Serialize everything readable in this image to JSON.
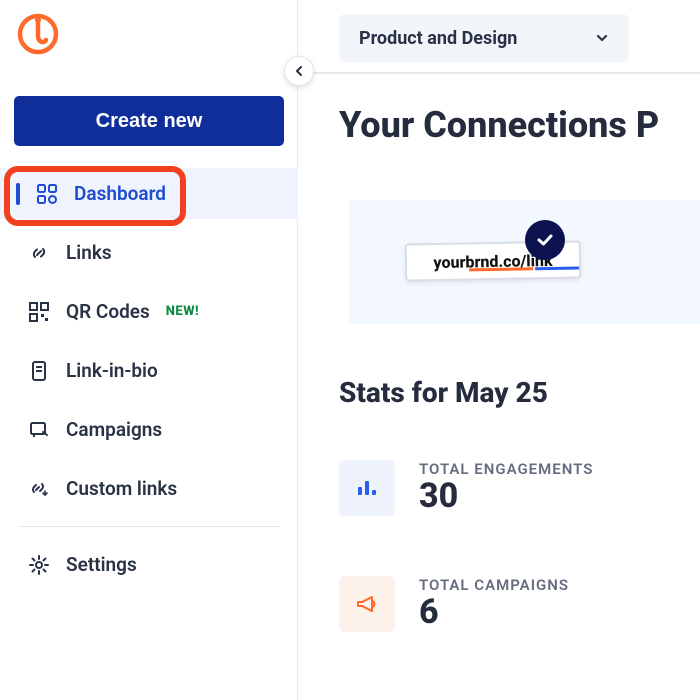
{
  "brand": {
    "name": "Bitly"
  },
  "sidebar": {
    "create_label": "Create new",
    "items": [
      {
        "label": "Dashboard"
      },
      {
        "label": "Links"
      },
      {
        "label": "QR Codes",
        "badge": "NEW!"
      },
      {
        "label": "Link-in-bio"
      },
      {
        "label": "Campaigns"
      },
      {
        "label": "Custom links"
      },
      {
        "label": "Settings"
      }
    ]
  },
  "header": {
    "workspace_selector": "Product and Design"
  },
  "main": {
    "title": "Your Connections P",
    "promo_link_text": "yourbrnd.co/link",
    "stats_title": "Stats for May 25",
    "stats": [
      {
        "label": "TOTAL ENGAGEMENTS",
        "value": "30"
      },
      {
        "label": "TOTAL CAMPAIGNS",
        "value": "6"
      }
    ]
  }
}
